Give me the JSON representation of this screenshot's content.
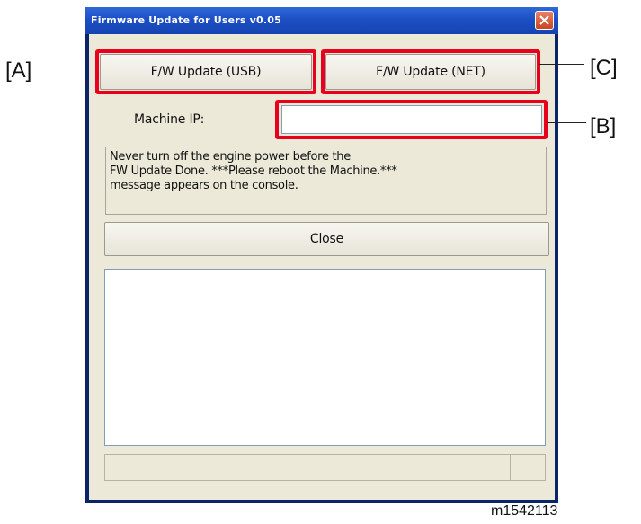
{
  "window": {
    "title": "Firmware Update for Users v0.05"
  },
  "buttons": {
    "usb_label": "F/W Update (USB)",
    "net_label": "F/W Update (NET)",
    "close_label": "Close"
  },
  "machine_ip": {
    "label": "Machine IP:",
    "value": ""
  },
  "message": {
    "text": "Never turn off the engine power before the\nFW Update Done. ***Please reboot the Machine.***\nmessage appears on the console."
  },
  "callouts": {
    "a": "[A]",
    "b": "[B]",
    "c": "[C]"
  },
  "figure_id": "m1542113",
  "colors": {
    "highlight": "#e8001c",
    "titlebar": "#1d4fc4",
    "dialog_bg": "#ece9d8"
  }
}
